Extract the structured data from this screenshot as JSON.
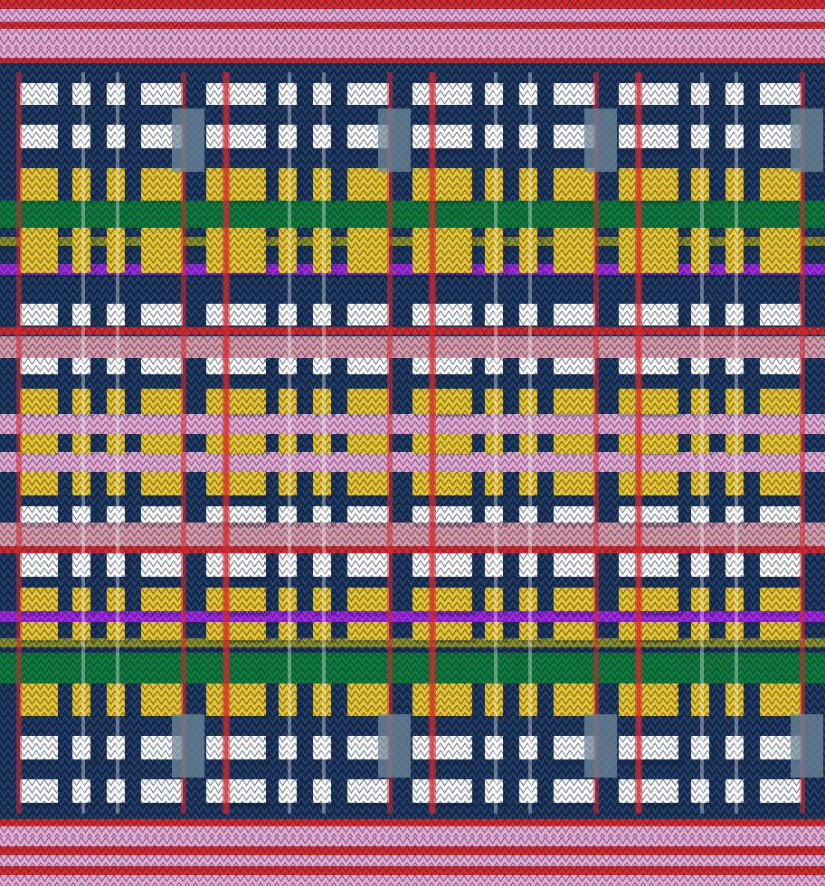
{
  "pattern": {
    "type": "knitted-plaid",
    "repeat_columns": 4,
    "colors": {
      "base": "#142848",
      "stitch_outline": "#0b1a33",
      "white": "#ffffff",
      "yellow": "#e9c52b",
      "red": "#d42a2e",
      "pink": "#e5a9d2",
      "green": "#0f7a3a",
      "purple": "#a128e0",
      "olive": "#8a8f2a",
      "slate": "#6f8a9a",
      "rose": "#d89aa8"
    }
  }
}
